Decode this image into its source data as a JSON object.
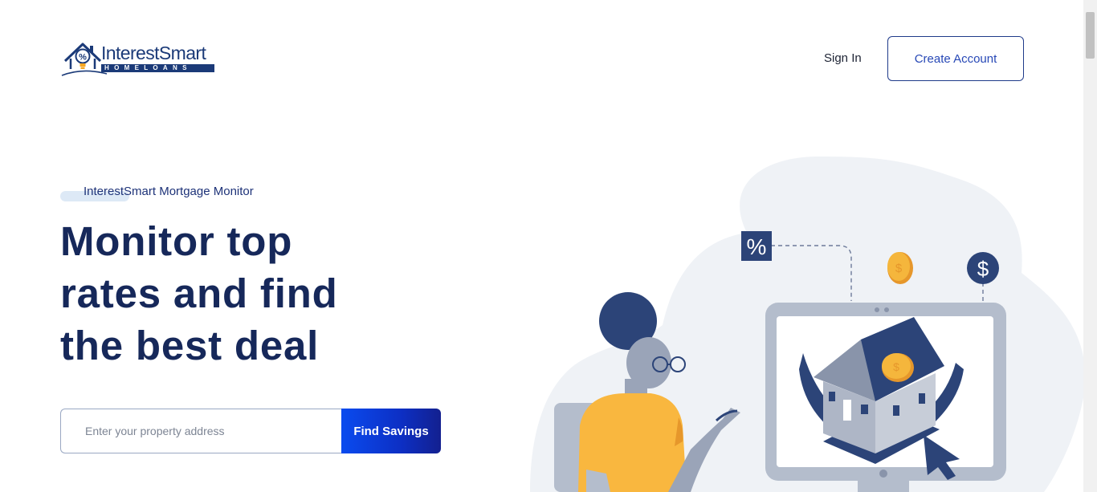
{
  "header": {
    "logo": {
      "name": "InterestSmart",
      "tagline": "HOMELOANS",
      "icon": "house-percent-icon"
    },
    "sign_in_label": "Sign In",
    "create_account_label": "Create Account"
  },
  "hero": {
    "eyebrow": "InterestSmart Mortgage Monitor",
    "headline_lines": [
      "Monitor top",
      "rates and find",
      "the best deal"
    ],
    "search": {
      "placeholder": "Enter your property address",
      "value": "",
      "button_label": "Find Savings"
    }
  },
  "illustration": {
    "icons": [
      "percent-icon",
      "coin-icon",
      "dollar-icon",
      "house-icon",
      "cursor-icon",
      "monitor-icon"
    ]
  },
  "colors": {
    "navy": "#16285a",
    "brand_blue": "#1f3a8a",
    "button_gradient_start": "#0a4bef",
    "button_gradient_end": "#13208f",
    "coin": "#f5b63c",
    "shirt": "#f9b73f",
    "blob": "#eff2f6"
  }
}
